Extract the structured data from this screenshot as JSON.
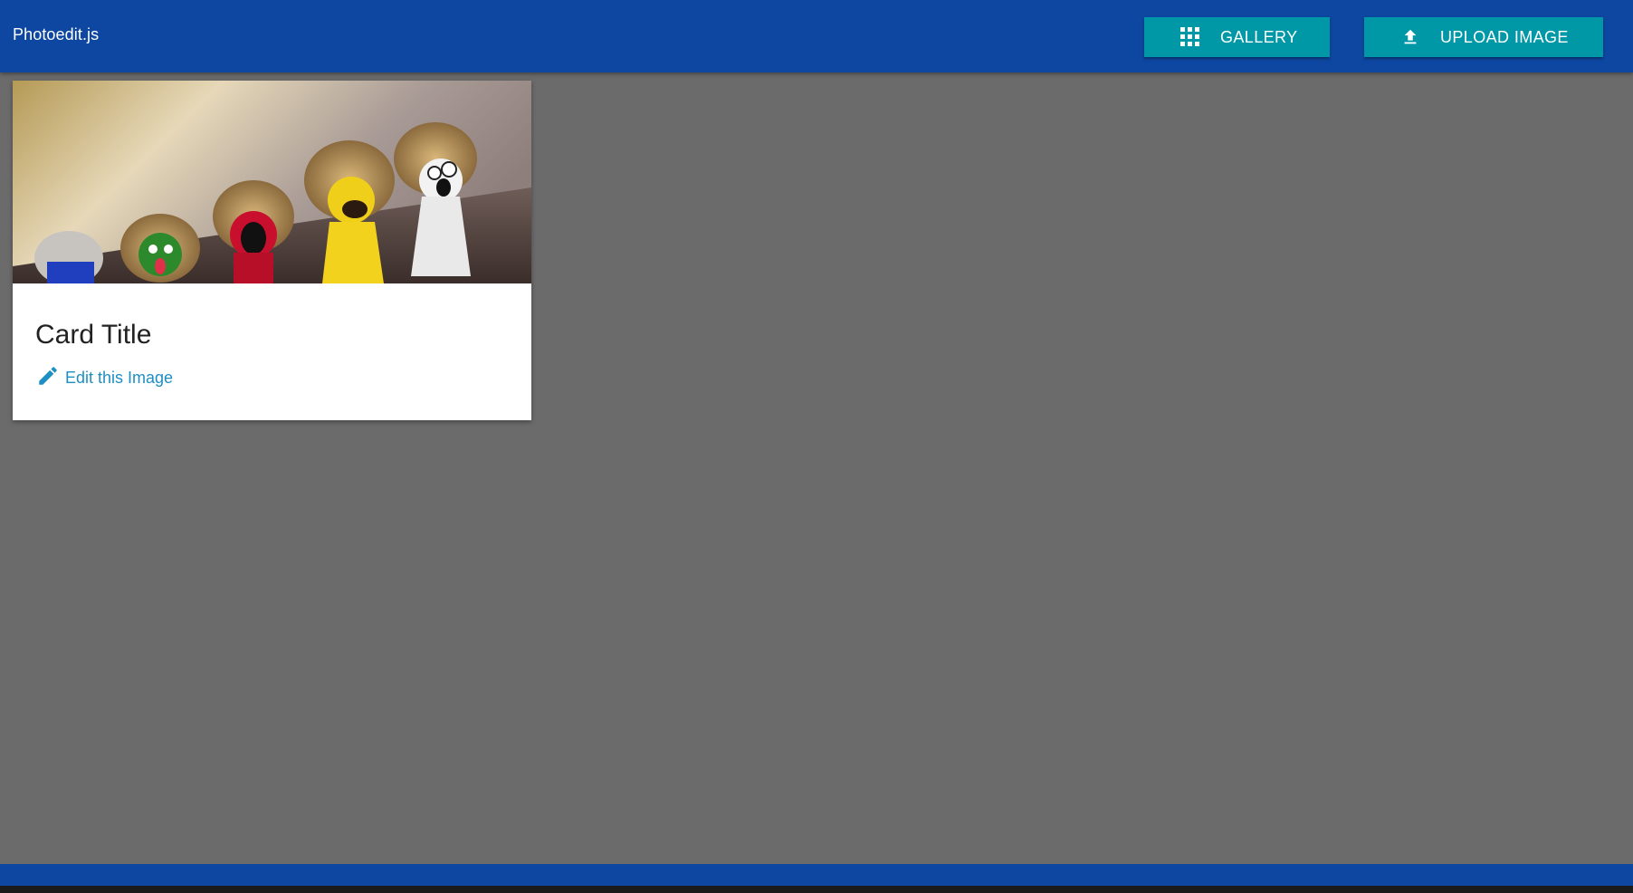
{
  "app": {
    "brand": "Photoedit.js"
  },
  "toolbar": {
    "gallery_label": "GALLERY",
    "upload_label": "UPLOAD IMAGE",
    "gallery_icon": "grid-icon",
    "upload_icon": "upload-icon"
  },
  "card": {
    "title": "Card Title",
    "action_label": "Edit this Image",
    "action_icon": "pencil-icon"
  },
  "colors": {
    "navbar": "#0d47a1",
    "button": "#0097a7",
    "background": "#6b6b6b",
    "link": "#1e8fc2"
  }
}
